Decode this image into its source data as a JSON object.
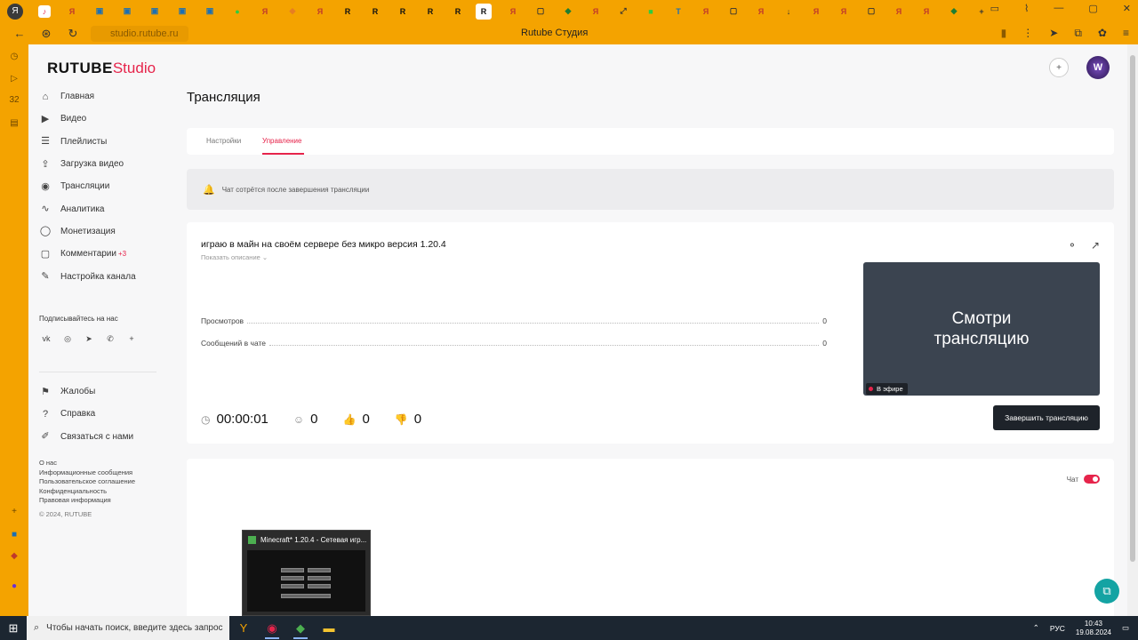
{
  "browser": {
    "url": "studio.rutube.ru",
    "page_title": "Rutube Студия"
  },
  "brand": {
    "name": "RUTUBE",
    "suffix": "Studio"
  },
  "sidebar": {
    "items": [
      {
        "label": "Главная",
        "icon": "home-icon"
      },
      {
        "label": "Видео",
        "icon": "video-icon"
      },
      {
        "label": "Плейлисты",
        "icon": "playlist-icon"
      },
      {
        "label": "Загрузка видео",
        "icon": "upload-icon"
      },
      {
        "label": "Трансляции",
        "icon": "broadcast-icon"
      },
      {
        "label": "Аналитика",
        "icon": "analytics-icon"
      },
      {
        "label": "Монетизация",
        "icon": "monetization-icon"
      },
      {
        "label": "Комментарии",
        "icon": "comments-icon",
        "badge": "+3"
      },
      {
        "label": "Настройка канала",
        "icon": "settings-icon"
      }
    ],
    "subscribe_title": "Подписывайтесь на нас",
    "secondary": [
      {
        "label": "Жалобы",
        "icon": "flag-icon"
      },
      {
        "label": "Справка",
        "icon": "help-icon"
      },
      {
        "label": "Связаться с нами",
        "icon": "contact-icon"
      }
    ],
    "footer": {
      "links": [
        "О нас",
        "Информационные сообщения",
        "Пользовательское соглашение",
        "Конфиденциальность",
        "Правовая информация"
      ],
      "copyright": "© 2024, RUTUBE"
    }
  },
  "main": {
    "title": "Трансляция",
    "tabs": [
      {
        "label": "Настройки",
        "active": false
      },
      {
        "label": "Управление",
        "active": true
      }
    ],
    "notice": "Чат сотрётся после завершения трансляции",
    "stream": {
      "title": "играю в майн на своём сервере без микро версия 1.20.4",
      "show_description": "Показать описание ⌄",
      "stats": [
        {
          "label": "Просмотров",
          "value": "0"
        },
        {
          "label": "Сообщений в чате",
          "value": "0"
        }
      ],
      "preview_text_line1": "Смотри",
      "preview_text_line2": "трансляцию",
      "live_label": "В эфире",
      "duration": "00:00:01",
      "viewers": "0",
      "likes": "0",
      "dislikes": "0",
      "end_button": "Завершить трансляцию"
    },
    "chat": {
      "toggle_label": "Чат",
      "enabled": true
    }
  },
  "thumbnail_popup": {
    "title": "Minecraft* 1.20.4 - Сетевая игр..."
  },
  "taskbar": {
    "search_placeholder": "Чтобы начать поиск, введите здесь запрос",
    "lang": "РУС",
    "time": "10:43",
    "date": "19.08.2024"
  },
  "colors": {
    "accent": "#e6244b",
    "browser": "#f4a300",
    "dark_button": "#1e232a",
    "fab": "#14a3a3"
  }
}
